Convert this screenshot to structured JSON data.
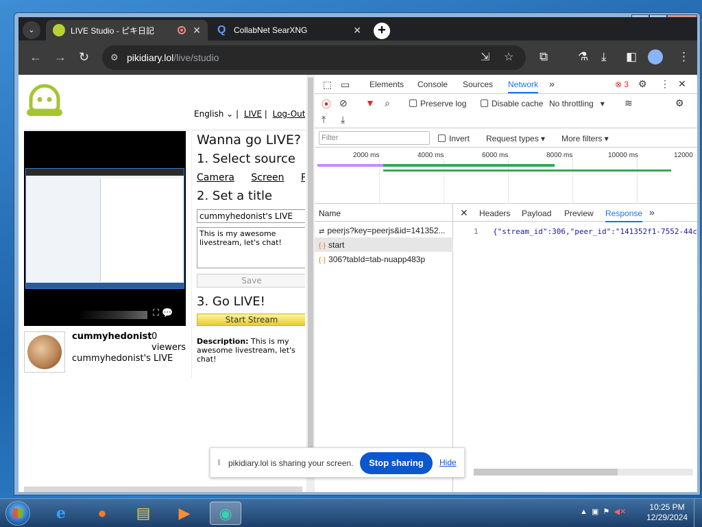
{
  "browser": {
    "tab1_title": "LIVE Studio - ピキ日記",
    "tab2_title": "CollabNet SearXNG",
    "url_host": "pikidiary.lol",
    "url_path": "/live/studio"
  },
  "page": {
    "lang": "English",
    "nav_live": "LIVE",
    "nav_logout": "Log-Out",
    "heading_live": "Wanna go LIVE?",
    "step1": "1. Select source",
    "src_camera": "Camera",
    "src_screen": "Screen",
    "src_partial": "P",
    "step2": "2. Set a title",
    "title_value": "cummyhedonist's LIVE",
    "desc_value": "This is my awesome livestream, let's chat!",
    "save_label": "Save",
    "step3": "3. Go LIVE!",
    "start_label": "Start Stream",
    "description_label": "Description:",
    "description_text": "This is my awesome livestream, let's chat!",
    "username": "cummyhedonist",
    "viewer_count": "0",
    "viewers_label": "viewers",
    "live_title": "cummyhedonist's LIVE"
  },
  "devtools": {
    "tabs": [
      "Elements",
      "Console",
      "Sources",
      "Network"
    ],
    "error_count": "3",
    "preserve_log": "Preserve log",
    "disable_cache": "Disable cache",
    "throttling": "No throttling",
    "filter_placeholder": "Filter",
    "invert": "Invert",
    "request_types": "Request types",
    "more_filters": "More filters",
    "timeline_ticks": [
      "2000 ms",
      "4000 ms",
      "6000 ms",
      "8000 ms",
      "10000 ms",
      "12000"
    ],
    "name_header": "Name",
    "requests": [
      "peerjs?key=peerjs&id=141352...",
      "start",
      "306?tabId=tab-nuapp483p"
    ],
    "detail_tabs": [
      "Headers",
      "Payload",
      "Preview",
      "Response"
    ],
    "line_number": "1",
    "response_text": "{\"stream_id\":306,\"peer_id\":\"141352f1-7552-44c"
  },
  "share_bar": {
    "message": "pikidiary.lol is sharing your screen.",
    "stop_label": "Stop sharing",
    "hide_label": "Hide"
  },
  "taskbar": {
    "time": "10:25 PM",
    "date": "12/29/2024"
  }
}
